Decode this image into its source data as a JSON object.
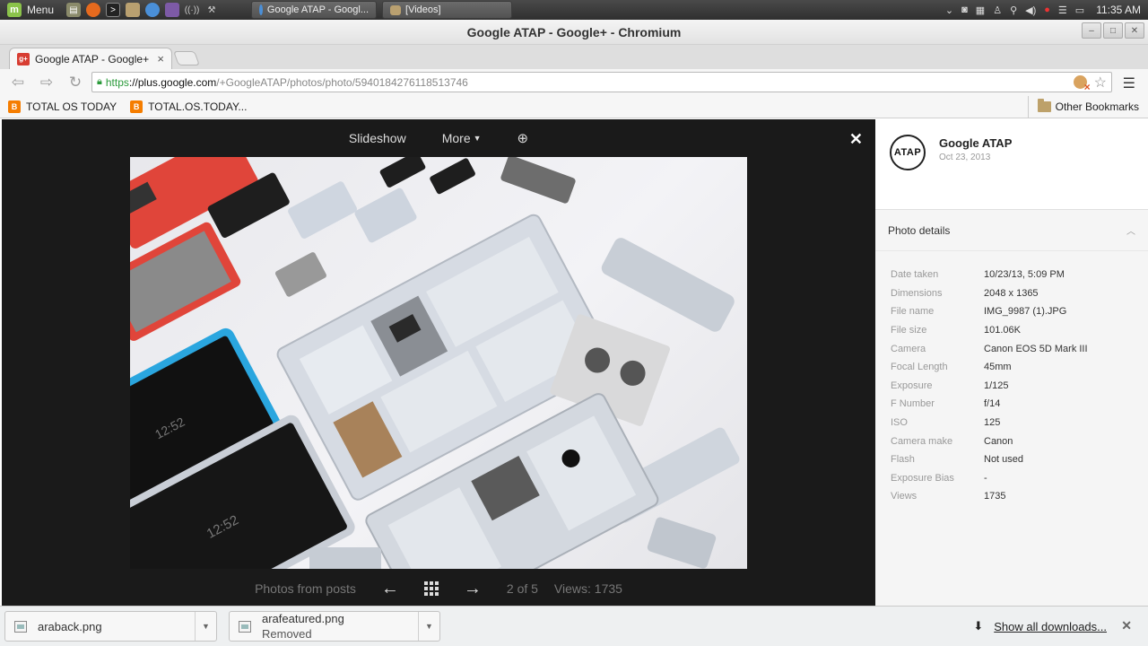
{
  "taskbar": {
    "menu_label": "Menu",
    "launchers": [
      "files-icon",
      "firefox-icon",
      "terminal-icon",
      "folder-icon",
      "chromium-icon",
      "image-viewer-icon",
      "wifi-icon",
      "wrench-icon"
    ],
    "windows": [
      {
        "label": "Google ATAP - Googl...",
        "icon": "chromium-icon"
      },
      {
        "label": "[Videos]",
        "icon": "folder-icon"
      }
    ],
    "clock": "11:35 AM"
  },
  "window": {
    "title": "Google ATAP - Google+ - Chromium"
  },
  "tabs": [
    {
      "label": "Google ATAP - Google+",
      "favicon": "g+"
    }
  ],
  "omnibox": {
    "scheme": "https",
    "host": "://plus.google.com",
    "path": "/+GoogleATAP/photos/photo/5940184276118513746"
  },
  "bookmarks": {
    "items": [
      {
        "label": "TOTAL OS TODAY",
        "icon": "blogger-icon",
        "icon_glyph": "B"
      },
      {
        "label": "TOTAL.OS.TODAY...",
        "icon": "blogger-icon",
        "icon_glyph": "B"
      }
    ],
    "other": "Other Bookmarks"
  },
  "viewer": {
    "slideshow": "Slideshow",
    "more": "More",
    "bottom": {
      "photos_from_posts": "Photos from posts",
      "position": "2 of 5",
      "views": "Views: 1735"
    }
  },
  "panel": {
    "author": "Google ATAP",
    "avatar_text": "ATAP",
    "date": "Oct 23, 2013",
    "details_title": "Photo details",
    "details": [
      {
        "label": "Date taken",
        "value": "10/23/13, 5:09 PM"
      },
      {
        "label": "Dimensions",
        "value": "2048 x 1365"
      },
      {
        "label": "File name",
        "value": "IMG_9987 (1).JPG"
      },
      {
        "label": "File size",
        "value": "101.06K"
      },
      {
        "label": "Camera",
        "value": "Canon EOS 5D Mark III"
      },
      {
        "label": "Focal Length",
        "value": "45mm"
      },
      {
        "label": "Exposure",
        "value": "1/125"
      },
      {
        "label": "F Number",
        "value": "f/14"
      },
      {
        "label": "ISO",
        "value": "125"
      },
      {
        "label": "Camera make",
        "value": "Canon"
      },
      {
        "label": "Flash",
        "value": "Not used"
      },
      {
        "label": "Exposure Bias",
        "value": "-"
      },
      {
        "label": "Views",
        "value": "1735"
      }
    ]
  },
  "downloads": {
    "items": [
      {
        "name": "araback.png",
        "status": ""
      },
      {
        "name": "arafeatured.png",
        "status": "Removed"
      }
    ],
    "show_all": "Show all downloads..."
  },
  "colors": {
    "viewer_bg": "#1a1a1a",
    "accent_red": "#d73d32",
    "secure_green": "#2a9a3a",
    "phone_blue": "#2aa6df",
    "phone_red": "#e0453a"
  }
}
